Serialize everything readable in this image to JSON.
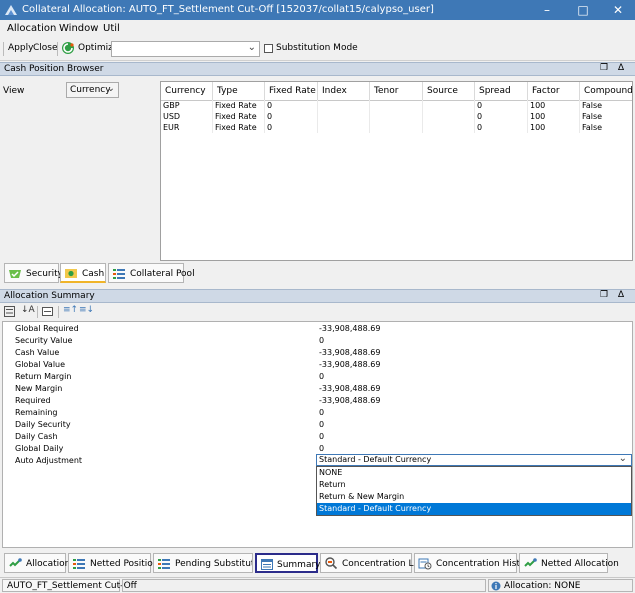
{
  "window": {
    "title": "Collateral Allocation: AUTO_FT_Settlement Cut-Off [152037/collat15/calypso_user]"
  },
  "menu": [
    "Allocation",
    "Window",
    "Util"
  ],
  "toolbar": {
    "apply_label": "Apply",
    "close_label": "Close",
    "optimize_label": "Optimize",
    "combo_value": "",
    "substitution_label": "Substitution Mode"
  },
  "cash_panel": {
    "title": "Cash Position Browser",
    "view_label": "View",
    "view_value": "Currency",
    "columns": [
      "Currency",
      "Type",
      "Fixed Rate",
      "Index",
      "Tenor",
      "Source",
      "Spread",
      "Factor",
      "Compound"
    ],
    "rows": [
      [
        "GBP",
        "Fixed Rate",
        "0",
        "",
        "",
        "",
        "0",
        "100",
        "False"
      ],
      [
        "USD",
        "Fixed Rate",
        "0",
        "",
        "",
        "",
        "0",
        "100",
        "False"
      ],
      [
        "EUR",
        "Fixed Rate",
        "0",
        "",
        "",
        "",
        "0",
        "100",
        "False"
      ]
    ],
    "tabs": [
      "Security",
      "Cash",
      "Collateral Pool"
    ]
  },
  "summary_panel": {
    "title": "Allocation Summary",
    "rows": [
      {
        "label": "Global Required",
        "value": "-33,908,488.69"
      },
      {
        "label": "Security Value",
        "value": "0"
      },
      {
        "label": "Cash Value",
        "value": "-33,908,488.69"
      },
      {
        "label": "Global Value",
        "value": "-33,908,488.69"
      },
      {
        "label": "Return Margin",
        "value": "0"
      },
      {
        "label": "New Margin",
        "value": "-33,908,488.69"
      },
      {
        "label": "Required",
        "value": "-33,908,488.69"
      },
      {
        "label": "Remaining",
        "value": "0"
      },
      {
        "label": "Daily Security",
        "value": "0"
      },
      {
        "label": "Daily Cash",
        "value": "0"
      },
      {
        "label": "Global Daily",
        "value": "0"
      },
      {
        "label": "Auto Adjustment",
        "value": "Standard - Default Currency"
      }
    ],
    "dropdown_options": [
      "NONE",
      "Return",
      "Return & New Margin",
      "Standard - Default Currency"
    ],
    "dropdown_selected_index": 3
  },
  "bottom_tabs": [
    "Allocation",
    "Netted Positions",
    "Pending Substitutions",
    "Summary",
    "Concentration Limits",
    "Concentration History",
    "Netted Allocation"
  ],
  "active_bottom_tab": "Summary",
  "status": {
    "left": "AUTO_FT_Settlement Cut-Off",
    "right": "Allocation: NONE"
  },
  "colors": {
    "titlebar": "#3e78b6",
    "selection": "#0078d7",
    "pane_header": "#cfd9e6",
    "active_tab_border": "#2b2b8a"
  }
}
